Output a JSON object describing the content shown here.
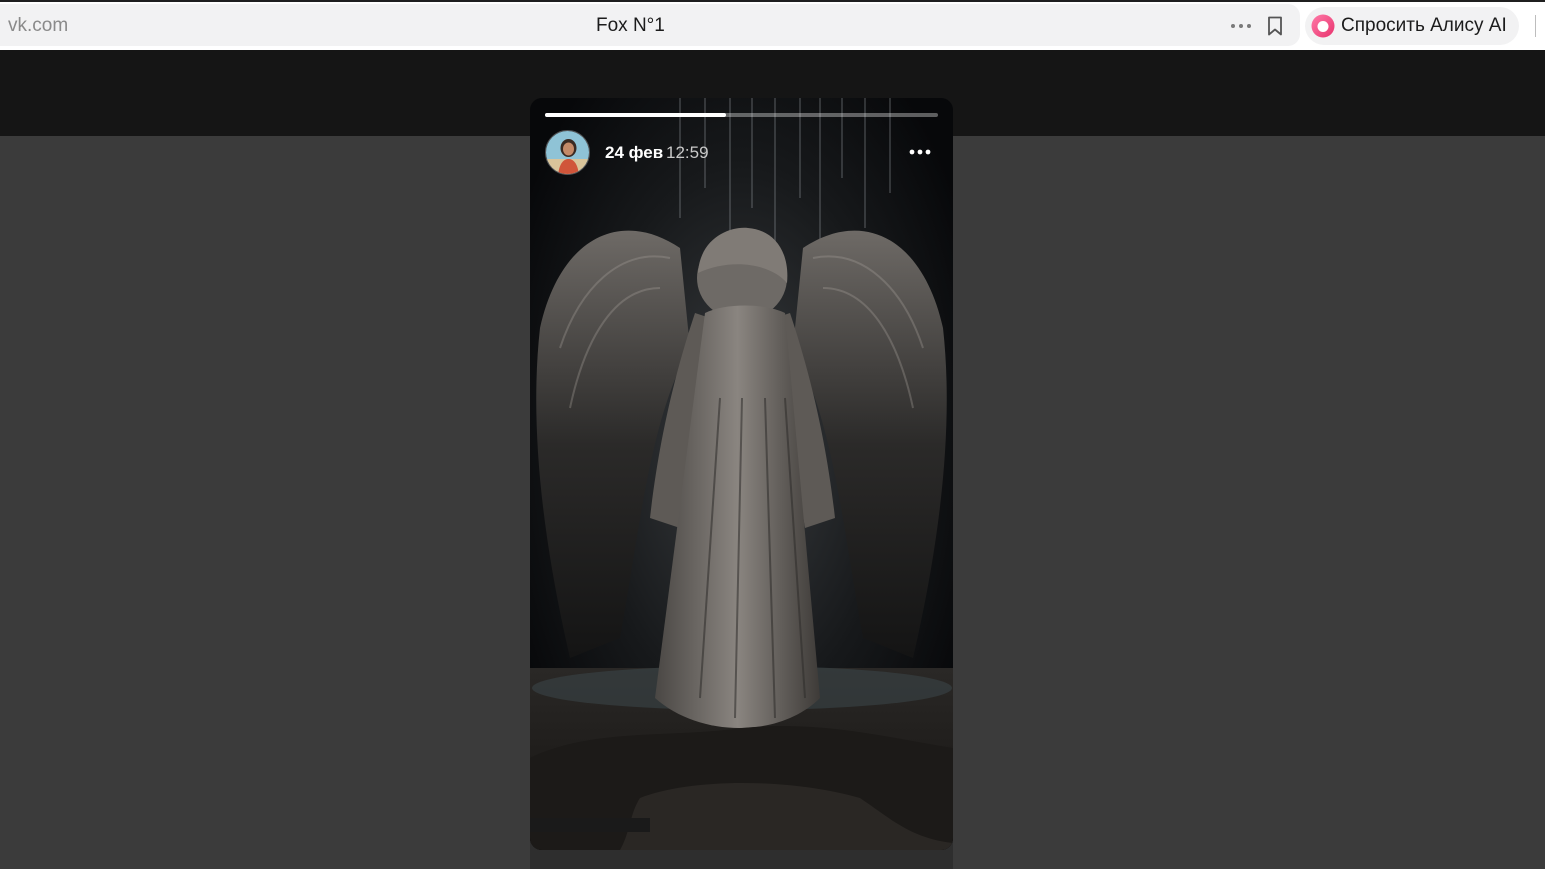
{
  "browser": {
    "url": "vk.com",
    "tab_title": "Fox N°1",
    "alice_label": "Спросить Алису AI"
  },
  "story": {
    "date": "24 фев",
    "time": "12:59",
    "progress": 0.46
  },
  "colors": {
    "alice_accent": "#ff4f87",
    "story_bg": "#0d0f11",
    "backdrop": "#3b3b3b"
  },
  "icons": {
    "more": "more-horizontal-icon",
    "bookmark": "bookmark-icon",
    "alice": "alice-icon",
    "story_menu": "more-horizontal-icon"
  }
}
